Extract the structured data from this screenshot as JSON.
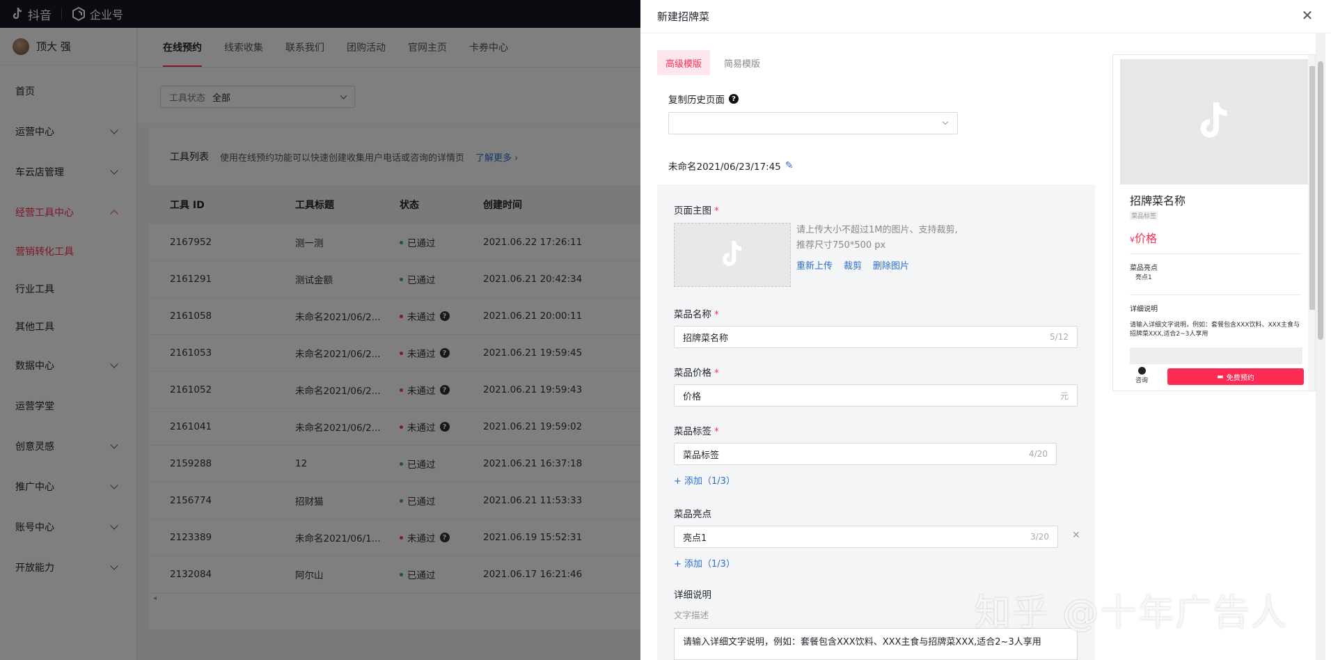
{
  "brand": {
    "douyin": "抖音",
    "enterprise": "企业号"
  },
  "user": {
    "name": "顶大 强"
  },
  "sidebar": {
    "items": [
      {
        "label": "首页",
        "chevron": false
      },
      {
        "label": "运营中心",
        "chevron": true
      },
      {
        "label": "车云店管理",
        "chevron": true
      },
      {
        "label": "经营工具中心",
        "chevron": true,
        "active": true
      }
    ],
    "sub_items": [
      {
        "label": "营销转化工具",
        "active": true
      },
      {
        "label": "行业工具"
      },
      {
        "label": "其他工具"
      }
    ],
    "items_after": [
      {
        "label": "数据中心",
        "chevron": true
      },
      {
        "label": "运营学堂",
        "chevron": false
      },
      {
        "label": "创意灵感",
        "chevron": true
      },
      {
        "label": "推广中心",
        "chevron": true
      },
      {
        "label": "账号中心",
        "chevron": true
      },
      {
        "label": "开放能力",
        "chevron": true
      }
    ]
  },
  "main": {
    "tabs": [
      "在线预约",
      "线索收集",
      "联系我们",
      "团购活动",
      "官网主页",
      "卡券中心"
    ],
    "filter": {
      "label": "工具状态",
      "value": "全部"
    },
    "list": {
      "title": "工具列表",
      "desc": "使用在线预约功能可以快速创建收集用户电话或咨询的详情页",
      "more": "了解更多"
    },
    "table": {
      "headers": [
        "工具 ID",
        "工具标题",
        "状态",
        "创建时间"
      ],
      "rows": [
        {
          "id": "2167952",
          "title": "测一测",
          "status": "已通过",
          "ok": true,
          "time": "2021.06.22 17:26:11"
        },
        {
          "id": "2161291",
          "title": "测试金额",
          "status": "已通过",
          "ok": true,
          "time": "2021.06.21 20:42:34"
        },
        {
          "id": "2161058",
          "title": "未命名2021/06/2...",
          "status": "未通过",
          "ok": false,
          "time": "2021.06.21 20:00:11"
        },
        {
          "id": "2161053",
          "title": "未命名2021/06/2...",
          "status": "未通过",
          "ok": false,
          "time": "2021.06.21 19:59:45"
        },
        {
          "id": "2161052",
          "title": "未命名2021/06/2...",
          "status": "未通过",
          "ok": false,
          "time": "2021.06.21 19:59:43"
        },
        {
          "id": "2161041",
          "title": "未命名2021/06/2...",
          "status": "未通过",
          "ok": false,
          "time": "2021.06.21 19:59:02"
        },
        {
          "id": "2159288",
          "title": "12",
          "status": "已通过",
          "ok": true,
          "time": "2021.06.21 16:37:18"
        },
        {
          "id": "2156774",
          "title": "招财猫",
          "status": "已通过",
          "ok": true,
          "time": "2021.06.21 11:53:33"
        },
        {
          "id": "2123389",
          "title": "未命名2021/06/1...",
          "status": "未通过",
          "ok": false,
          "time": "2021.06.19 15:52:31"
        },
        {
          "id": "2132084",
          "title": "阿尔山",
          "status": "已通过",
          "ok": true,
          "time": "2021.06.17 16:21:46"
        }
      ]
    }
  },
  "drawer": {
    "title": "新建招牌菜",
    "modes": [
      "高级模版",
      "简易模版"
    ],
    "copy_history_label": "复制历史页面",
    "page_name": "未命名2021/06/23/17:45",
    "form": {
      "main_image_label": "页面主图",
      "upload_tip_1": "请上传大小不超过1M的图片、支持裁剪,",
      "upload_tip_2": "推荐尺寸750*500 px",
      "reupload": "重新上传",
      "crop": "裁剪",
      "delete_image": "删除图片",
      "dish_name_label": "菜品名称",
      "dish_name_value": "招牌菜名称",
      "dish_name_count": "5/12",
      "price_label": "菜品价格",
      "price_value": "价格",
      "price_unit": "元",
      "tag_label": "菜品标签",
      "tag_value": "菜品标签",
      "tag_count": "4/20",
      "tag_add": "+ 添加（1/3）",
      "highlight_label": "菜品亮点",
      "highlight_value": "亮点1",
      "highlight_count": "3/20",
      "highlight_add": "+ 添加（1/3）",
      "detail_label": "详细说明",
      "detail_sub": "文字描述",
      "detail_value": "请输入详细文字说明，例如：套餐包含XXX饮料、XXX主食与招牌菜XXX,适合2~3人享用"
    },
    "preview": {
      "title": "招牌菜名称",
      "tag": "菜品标签",
      "currency": "¥",
      "price": "价格",
      "highlight_head": "菜品亮点",
      "highlight_item": "亮点1",
      "detail_head": "详细说明",
      "detail_text": "请输入详细文字说明，例如：套餐包含XXX饮料、XXX主食与招牌菜XXX,适合2~3人享用",
      "consult": "咨询",
      "book": "免费预约"
    }
  },
  "watermark": "知乎 @十年广告人"
}
